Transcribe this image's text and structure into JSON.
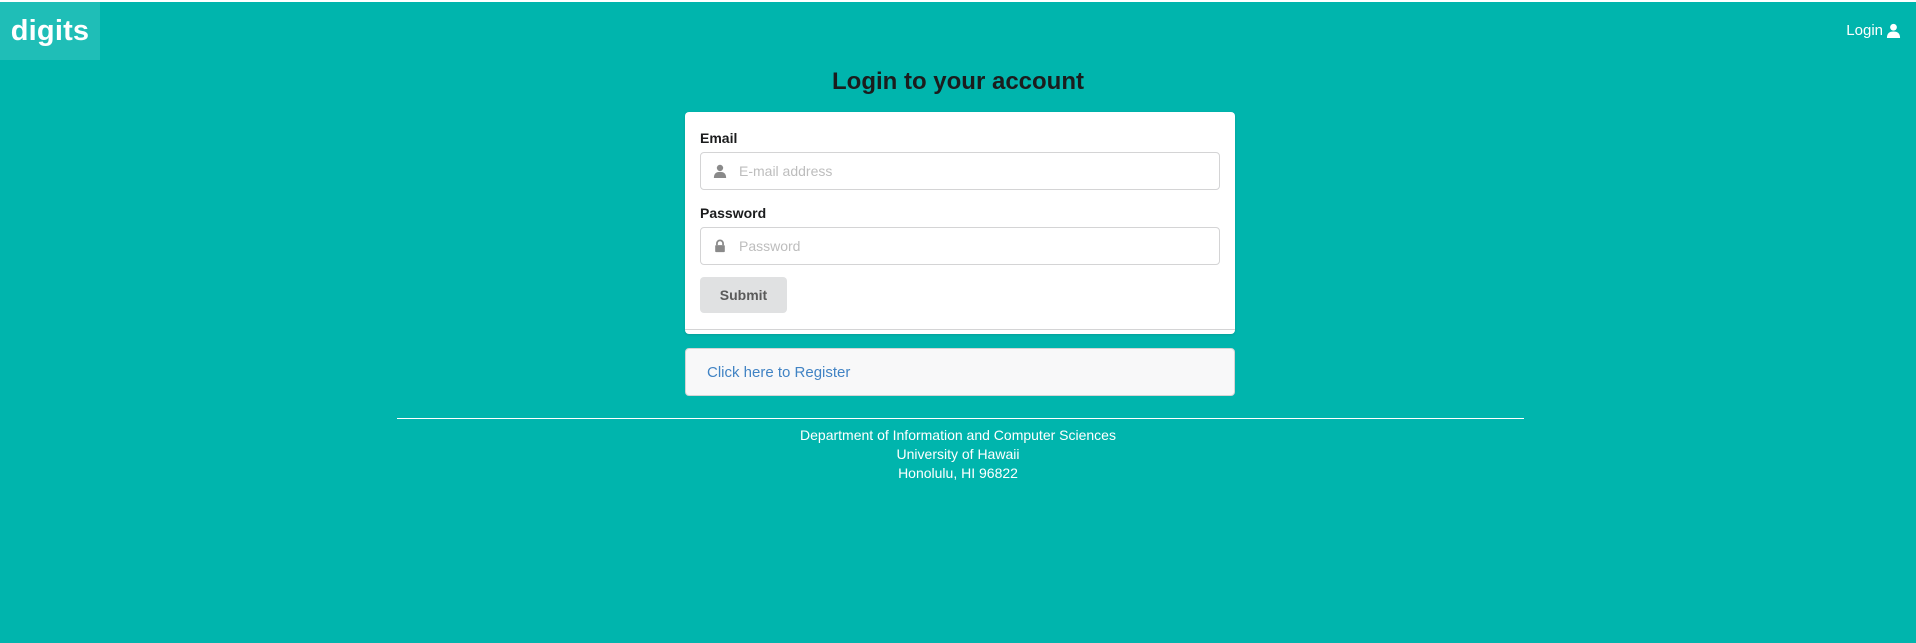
{
  "navbar": {
    "brand": "digits",
    "login_label": "Login"
  },
  "page": {
    "title": "Login to your account"
  },
  "form": {
    "email_label": "Email",
    "email_placeholder": "E-mail address",
    "email_value": "",
    "password_label": "Password",
    "password_placeholder": "Password",
    "password_value": "",
    "submit_label": "Submit"
  },
  "register": {
    "link_text": "Click here to Register"
  },
  "footer": {
    "line1": "Department of Information and Computer Sciences",
    "line2": "University of Hawaii",
    "line3": "Honolulu, HI 96822"
  },
  "icons": {
    "nav_login": "user-icon",
    "email": "user-icon",
    "password": "lock-icon"
  },
  "colors": {
    "background": "#00b5ad",
    "link": "#4183c4",
    "button": "#e0e1e2"
  }
}
